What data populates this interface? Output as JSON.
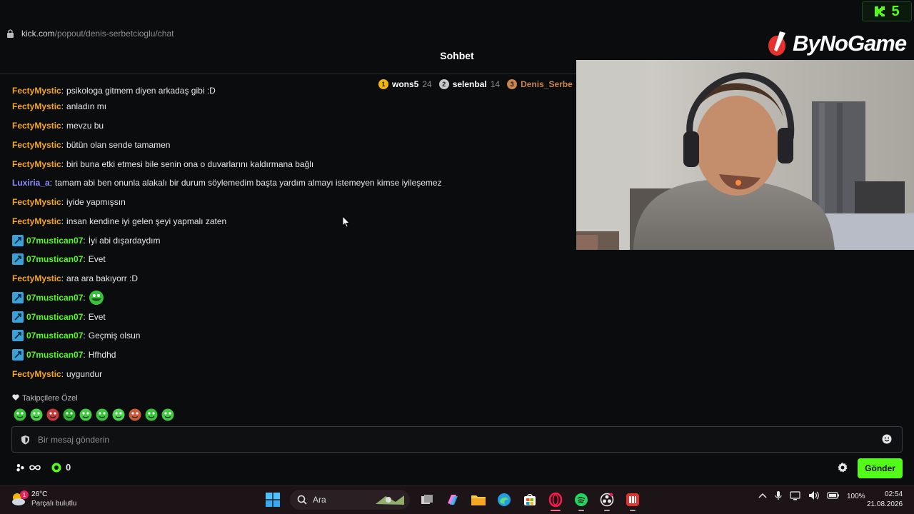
{
  "browser": {
    "url_host": "kick.com",
    "url_path": "/popout/denis-serbetcioglu/chat"
  },
  "chat": {
    "title": "Sohbet",
    "leaderboard": [
      {
        "rank": "1",
        "name": "wons5",
        "count": "24",
        "color": "#f2b705"
      },
      {
        "rank": "2",
        "name": "selenbal",
        "count": "14",
        "color": "#c8c8c8"
      },
      {
        "rank": "3",
        "name": "Denis_Serbe",
        "count": "",
        "color": "#c98550"
      }
    ],
    "messages": [
      {
        "user": "FectyMystic",
        "text": "psikologa gitmem diyen arkadaş gibi :D",
        "color": "#f5a623",
        "badge": false
      },
      {
        "user": "FectyMystic",
        "text": "anladın mı",
        "color": "#f5a623",
        "badge": false
      },
      {
        "user": "FectyMystic",
        "text": "mevzu bu",
        "color": "#f5a623",
        "badge": false
      },
      {
        "user": "FectyMystic",
        "text": "bütün olan sende tamamen",
        "color": "#f5a623",
        "badge": false
      },
      {
        "user": "FectyMystic",
        "text": "biri buna etki etmesi bile senin ona o duvarlarını kaldırmana bağlı",
        "color": "#f5a623",
        "badge": false
      },
      {
        "user": "Luxiria_a",
        "text": "tamam abi ben onunla alakalı bir durum söylemedim başta yardım almayı istemeyen kimse iyileşemez",
        "color": "#8c8cff",
        "badge": false
      },
      {
        "user": "FectyMystic",
        "text": "iyide yapmışsın",
        "color": "#f5a623",
        "badge": false
      },
      {
        "user": "FectyMystic",
        "text": "insan kendine iyi gelen şeyi yapmalı zaten",
        "color": "#f5a623",
        "badge": false
      },
      {
        "user": "07mustican07",
        "text": "İyi abi dışardaydım",
        "color": "#53fc18",
        "badge": true
      },
      {
        "user": "07mustican07",
        "text": "Evet",
        "color": "#53fc18",
        "badge": true
      },
      {
        "user": "FectyMystic",
        "text": "ara ara bakıyorr :D",
        "color": "#f5a623",
        "badge": false
      },
      {
        "user": "07mustican07",
        "text": "",
        "color": "#53fc18",
        "badge": true,
        "emote": true
      },
      {
        "user": "07mustican07",
        "text": "Evet",
        "color": "#53fc18",
        "badge": true
      },
      {
        "user": "07mustican07",
        "text": "Geçmiş olsun",
        "color": "#53fc18",
        "badge": true
      },
      {
        "user": "07mustican07",
        "text": "Hfhdhd",
        "color": "#53fc18",
        "badge": true
      },
      {
        "user": "FectyMystic",
        "text": "uygundur",
        "color": "#f5a623",
        "badge": false
      }
    ],
    "followers_label": "Takipçilere Özel",
    "input_placeholder": "Bir mesaj gönderin",
    "points_count": "0",
    "send_label": "Gönder"
  },
  "overlay": {
    "logo_text": "ByNoGame",
    "k5_text": "5"
  },
  "taskbar": {
    "temperature": "26°C",
    "condition": "Parçalı bulutlu",
    "weather_badge": "1",
    "search_label": "Ara",
    "battery": "100%",
    "time": "02:54",
    "date": "21.08.2026"
  },
  "colors": {
    "accent": "#53fc18",
    "background": "#0b0c0e",
    "taskbar": "#1d1418"
  }
}
